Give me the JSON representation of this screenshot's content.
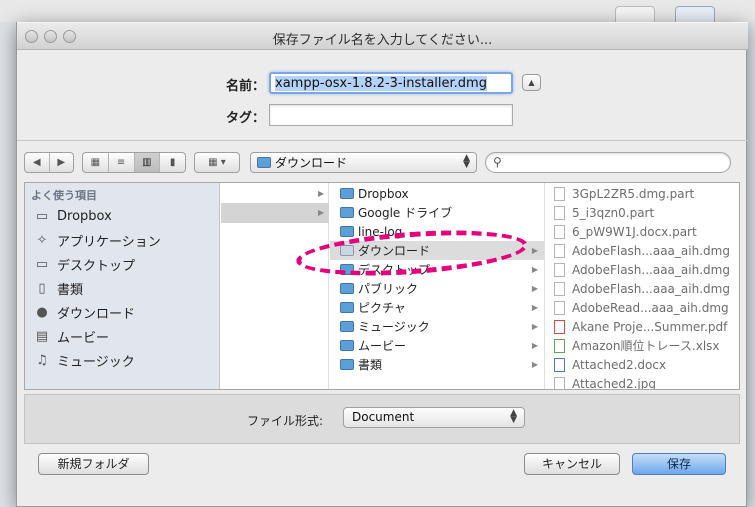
{
  "window": {
    "title": "保存ファイル名を入力してください..."
  },
  "save": {
    "name_label": "名前：",
    "filename": "xampp-osx-1.8.2-3-installer.dmg",
    "tag_label": "タグ："
  },
  "toolbar": {
    "location": "ダウンロード",
    "search_placeholder": ""
  },
  "sidebar": {
    "heading": "よく使う項目",
    "items": [
      {
        "label": "Dropbox",
        "icon": "folder-icon"
      },
      {
        "label": "アプリケーション",
        "icon": "applications-icon"
      },
      {
        "label": "デスクトップ",
        "icon": "desktop-icon"
      },
      {
        "label": "書類",
        "icon": "documents-icon"
      },
      {
        "label": "ダウンロード",
        "icon": "downloads-icon"
      },
      {
        "label": "ムービー",
        "icon": "movies-icon"
      },
      {
        "label": "ミュージック",
        "icon": "music-icon"
      }
    ]
  },
  "columns": {
    "middle": [
      {
        "label": "Dropbox"
      },
      {
        "label": "Google ドライブ"
      },
      {
        "label": "line-log"
      },
      {
        "label": "ダウンロード"
      },
      {
        "label": "デスクトップ"
      },
      {
        "label": "パブリック"
      },
      {
        "label": "ピクチャ"
      },
      {
        "label": "ミュージック"
      },
      {
        "label": "ムービー"
      },
      {
        "label": "書類"
      }
    ],
    "files": [
      {
        "label": "3GpL2ZR5.dmg.part"
      },
      {
        "label": "5_i3qzn0.part"
      },
      {
        "label": "6_pW9W1J.docx.part"
      },
      {
        "label": "AdobeFlash...aaa_aih.dmg"
      },
      {
        "label": "AdobeFlash...aaa_aih.dmg"
      },
      {
        "label": "AdobeFlash...aaa_aih.dmg"
      },
      {
        "label": "AdobeRead...aaa_aih.dmg"
      },
      {
        "label": "Akane Proje...Summer.pdf"
      },
      {
        "label": "Amazon順位トレース.xlsx"
      },
      {
        "label": "Attached2.docx"
      },
      {
        "label": "Attached2.jpg"
      }
    ]
  },
  "footer": {
    "format_label": "ファイル形式:",
    "format_value": "Document",
    "new_folder": "新規フォルダ",
    "cancel": "キャンセル",
    "save": "保存"
  },
  "colors": {
    "highlight": "#e6007e",
    "primary_button": "#6ea7ec",
    "selection": "#b4d1f6"
  }
}
